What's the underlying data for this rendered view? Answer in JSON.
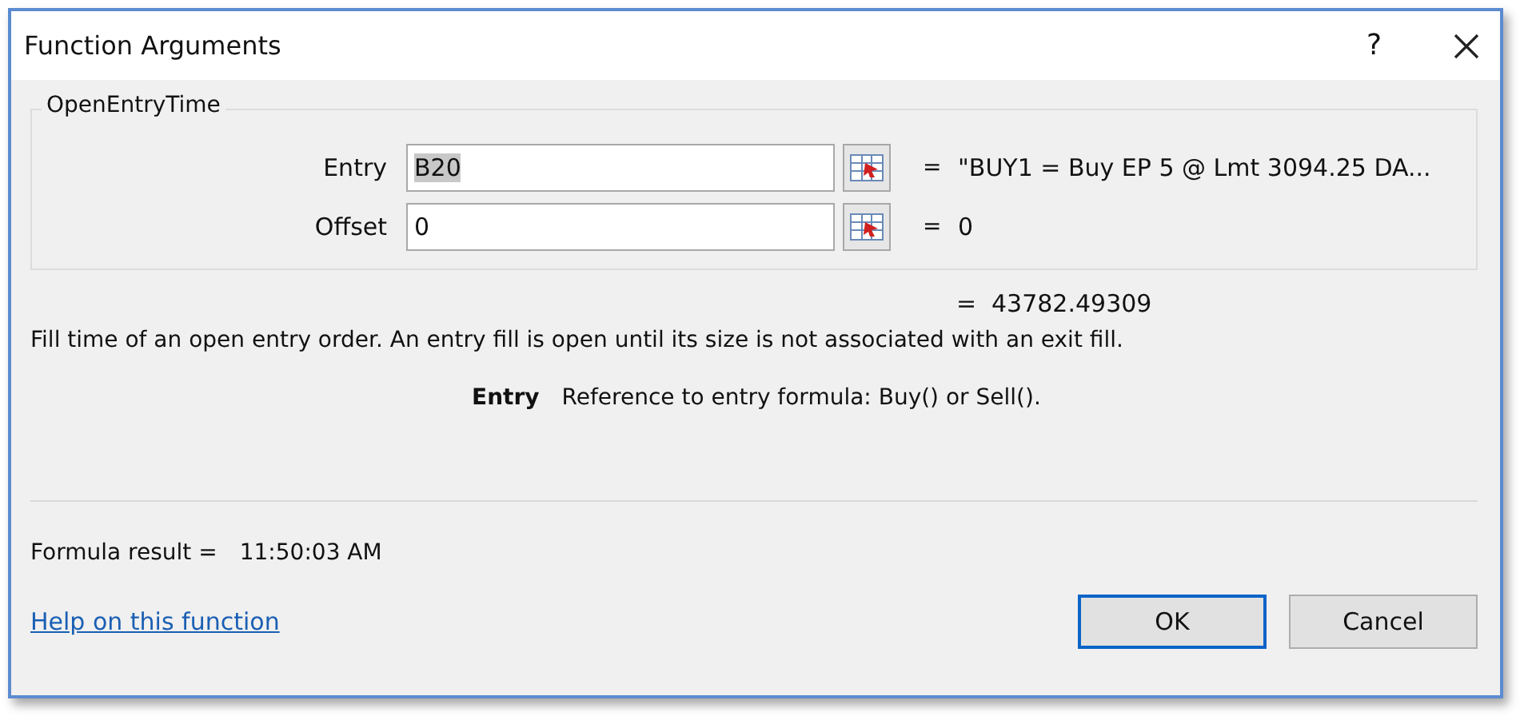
{
  "window": {
    "title": "Function Arguments",
    "help": "?"
  },
  "function_name": "OpenEntryTime",
  "arguments": [
    {
      "label": "Entry",
      "value": "B20",
      "value_selected": true,
      "equals": "=",
      "result": "\"BUY1 = Buy EP 5 @ Lmt 3094.25 DA..."
    },
    {
      "label": "Offset",
      "value": "0",
      "value_selected": false,
      "equals": "=",
      "result": "0"
    }
  ],
  "function_result": {
    "equals": "=",
    "value": "43782.49309"
  },
  "description": "Fill time of an open entry order. An entry fill is open until its size is not associated with an exit fill.",
  "argument_help": {
    "name": "Entry",
    "text": "Reference to entry formula: Buy() or Sell()."
  },
  "formula_result": {
    "label": "Formula result =",
    "value": "11:50:03 AM"
  },
  "help_link": "Help on this function",
  "buttons": [
    {
      "label": "OK",
      "default": true
    },
    {
      "label": "Cancel",
      "default": false
    }
  ]
}
